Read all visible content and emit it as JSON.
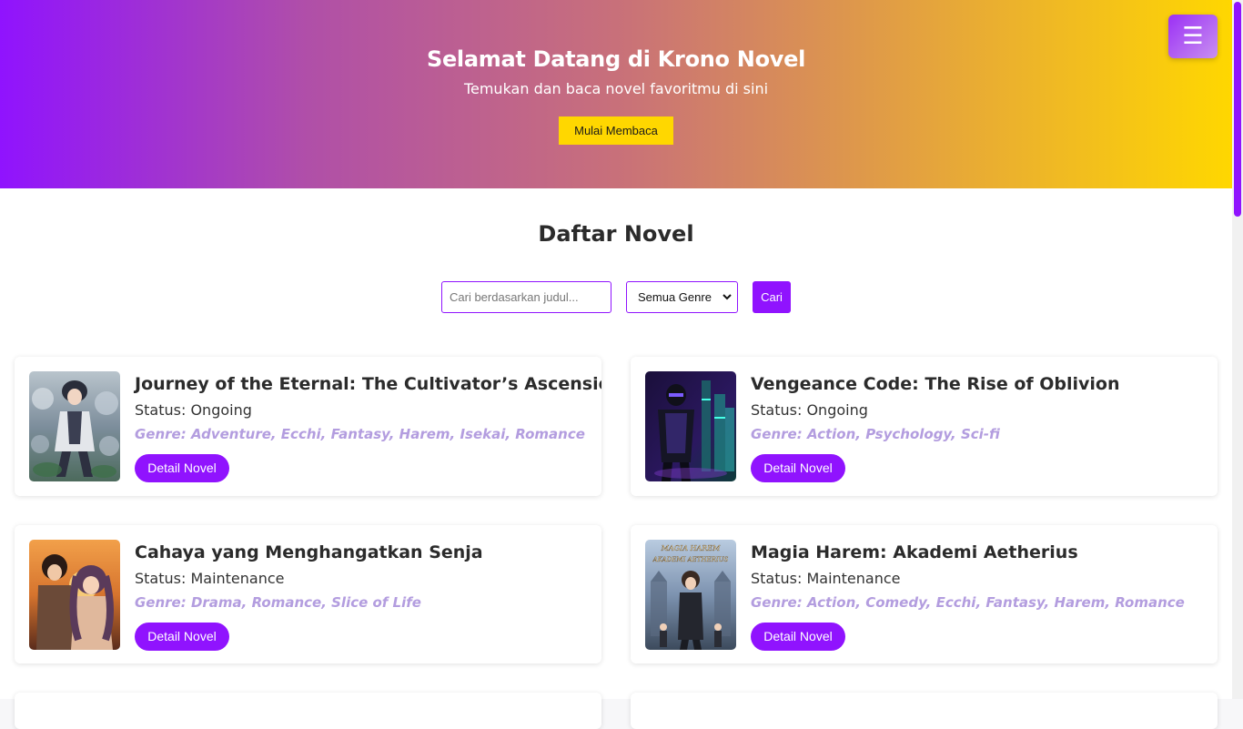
{
  "hero": {
    "title": "Selamat Datang di Krono Novel",
    "subtitle": "Temukan dan baca novel favoritmu di sini",
    "cta_label": "Mulai Membaca",
    "menu_icon": "☰"
  },
  "list": {
    "title": "Daftar Novel",
    "search_placeholder": "Cari berdasarkan judul...",
    "genre_selected": "Semua Genre",
    "search_button": "Cari"
  },
  "novels": [
    {
      "title": "Journey of the Eternal: The Cultivator’s Ascension",
      "status": "Status: Ongoing",
      "genre": "Genre: Adventure, Ecchi, Fantasy, Harem, Isekai, Romance",
      "button": "Detail Novel"
    },
    {
      "title": "Vengeance Code: The Rise of Oblivion",
      "status": "Status: Ongoing",
      "genre": "Genre: Action, Psychology, Sci-fi",
      "button": "Detail Novel"
    },
    {
      "title": "Cahaya yang Menghangatkan Senja",
      "status": "Status: Maintenance",
      "genre": "Genre: Drama, Romance, Slice of Life",
      "button": "Detail Novel"
    },
    {
      "title": "Magia Harem: Akademi Aetherius",
      "status": "Status: Maintenance",
      "genre": "Genre: Action, Comedy, Ecchi, Fantasy, Harem, Romance",
      "button": "Detail Novel",
      "cover_text": "MAGIA HAREM\nAKADEMI AETHERIUS"
    }
  ],
  "colors": {
    "accent": "#9013fe",
    "yellow": "#ffd700",
    "genre": "#b39ddf"
  }
}
